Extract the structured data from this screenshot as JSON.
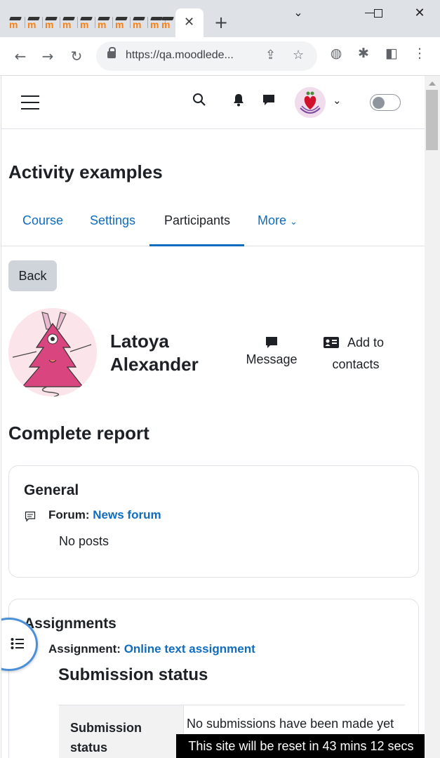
{
  "browser": {
    "url": "https://qa.moodlede...",
    "tab_close": "✕",
    "new_tab": "+",
    "favicon_letter": "m"
  },
  "navbar": {
    "icons": [
      "menu-icon",
      "search-icon",
      "bell-icon",
      "chat-icon",
      "user-avatar",
      "chevron-down-icon",
      "edit-mode-toggle"
    ]
  },
  "page": {
    "title": "Activity examples"
  },
  "secondary_nav": {
    "items": [
      "Course",
      "Settings",
      "Participants",
      "More"
    ],
    "active": "Participants"
  },
  "back_button": "Back",
  "user": {
    "first_name": "Latoya",
    "last_name": "Alexander",
    "message_label": "Message",
    "add_label_1": "Add to",
    "add_label_2": "contacts"
  },
  "report": {
    "title": "Complete report",
    "general": {
      "heading": "General",
      "forum_prefix": "Forum:",
      "forum_link": "News forum",
      "no_posts": "No posts"
    },
    "assignments": {
      "heading": "Assignments",
      "assignment_prefix": "Assignment:",
      "assignment_link": "Online text assignment",
      "submission_heading": "Submission status",
      "status_label_1": "Submission",
      "status_label_2": "status",
      "status_value": "No submissions have been made yet"
    }
  },
  "banner": "This site will be reset in 43 mins 12 secs",
  "colors": {
    "link": "#0f6cbf",
    "text": "#1d2125",
    "back_button_bg": "#ced4da"
  }
}
